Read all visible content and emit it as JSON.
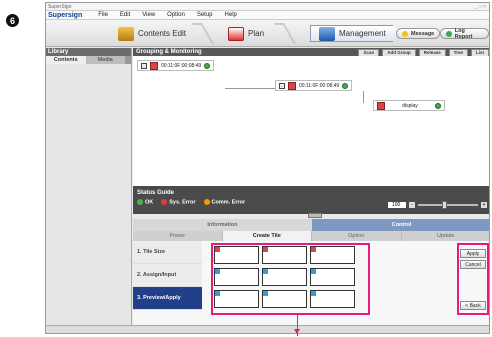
{
  "step_number": "6",
  "window": {
    "title": "SuperSign",
    "controls": "_ □ ×"
  },
  "menu": {
    "brand": "Supersign",
    "items": [
      "File",
      "Edit",
      "View",
      "Option",
      "Setup",
      "Help"
    ]
  },
  "toolbar": {
    "tabs": [
      "Contents Edit",
      "Plan",
      "Management"
    ],
    "active_tab": "Management",
    "message_button": "Message",
    "log_report_button": "Log Report"
  },
  "library": {
    "title": "Library",
    "tabs": [
      "Contents",
      "Media"
    ]
  },
  "grouping": {
    "title": "Grouping & Monitoring",
    "buttons": [
      "Scan",
      "Add Group",
      "Release",
      "Tree",
      "List"
    ],
    "nodes": [
      {
        "label": "00:11:0F:00:08:49"
      },
      {
        "label": "00:11:0F:00:08:49"
      },
      {
        "label": "display"
      }
    ]
  },
  "status_guide": {
    "title": "Status Guide",
    "items": [
      {
        "label": "OK",
        "color": "#4caf50"
      },
      {
        "label": "Sys. Error",
        "color": "#e53935"
      },
      {
        "label": "Comm. Error",
        "color": "#ff9800"
      }
    ],
    "zoom_value": "100"
  },
  "panel": {
    "top_tabs": [
      "Information",
      "Control"
    ],
    "sub_tabs": [
      "Power",
      "Create Tile",
      "Option",
      "Update"
    ],
    "active_sub_tab": "Create Tile",
    "steps": [
      "1. Tile Size",
      "2. Assign/Input",
      "3. Preview/Apply"
    ],
    "active_step": "3. Preview/Apply",
    "tile_size_label": "Tile Size",
    "apply_button": "Apply",
    "cancel_button": "Cancel",
    "back_button": "< Back"
  },
  "colors": {
    "highlight": "#e61b7a",
    "accent": "#223f8a"
  }
}
